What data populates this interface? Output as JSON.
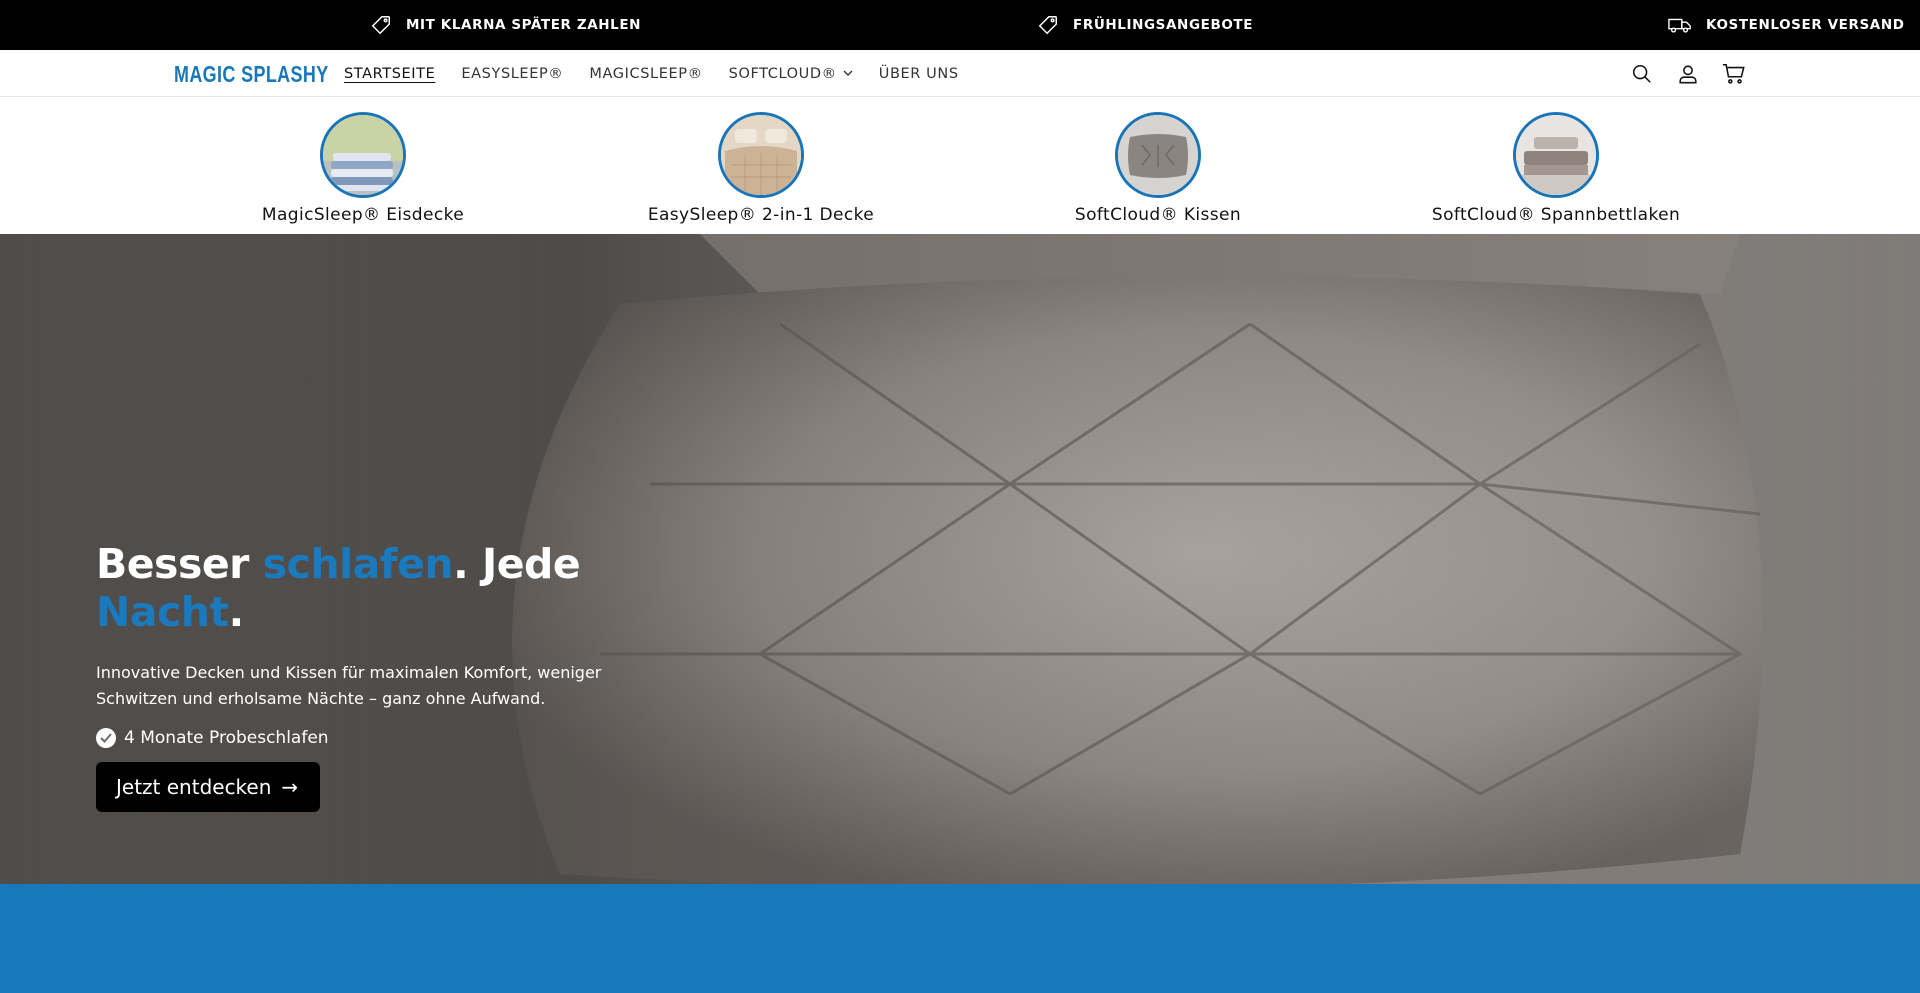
{
  "announcement_bar": {
    "items": [
      {
        "icon": "tag-icon",
        "text": "MIT KLARNA SPÄTER ZAHLEN"
      },
      {
        "icon": "tag-icon",
        "text": "FRÜHLINGSANGEBOTE"
      },
      {
        "icon": "truck-icon",
        "text": "KOSTENLOSER VERSAND"
      }
    ]
  },
  "header": {
    "logo": "MAGIC SPLASHY",
    "nav": [
      {
        "label": "STARTSEITE",
        "active": true
      },
      {
        "label": "EASYSLEEP®"
      },
      {
        "label": "MAGICSLEEP®"
      },
      {
        "label": "SOFTCLOUD®",
        "has_dropdown": true
      },
      {
        "label": "ÜBER UNS"
      }
    ],
    "icons": [
      "search-icon",
      "account-icon",
      "cart-icon"
    ]
  },
  "categories": [
    {
      "label": "MagicSleep® Eisdecke"
    },
    {
      "label": "EasySleep® 2-in-1 Decke"
    },
    {
      "label": "SoftCloud® Kissen"
    },
    {
      "label": "SoftCloud® Spannbettlaken"
    }
  ],
  "hero": {
    "title_parts": [
      "Besser ",
      "schlafen",
      ". Jede ",
      "Nacht",
      "."
    ],
    "subtitle": "Innovative Decken und Kissen für maximalen Komfort, weniger Schwitzen und erholsame Nächte – ganz ohne Aufwand.",
    "check_text": "4 Monate Probeschlafen",
    "cta_label": "Jetzt entdecken",
    "cta_arrow": "→"
  },
  "colors": {
    "brand_blue": "#1878b9",
    "announcement_bg": "#000000",
    "cta_bg": "#000000"
  }
}
